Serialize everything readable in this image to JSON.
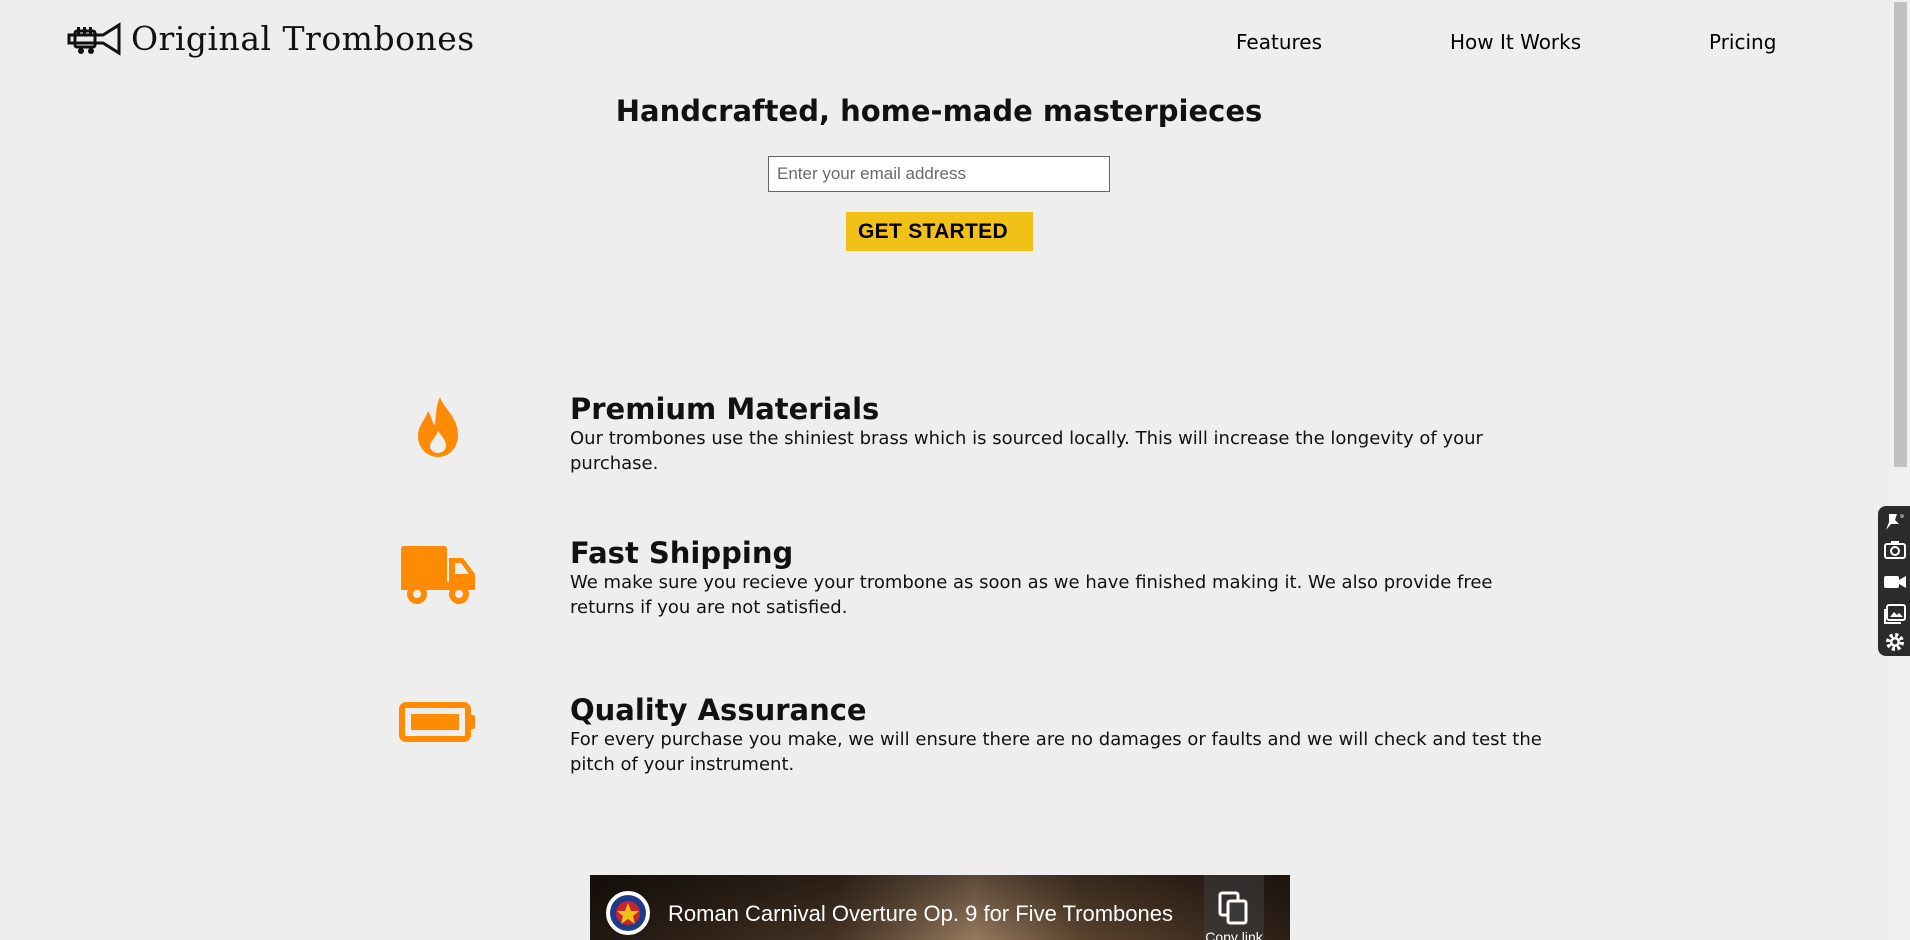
{
  "brand": {
    "name": "Original Trombones",
    "logo_icon": "trumpet-icon"
  },
  "nav": {
    "features": "Features",
    "how_it_works": "How It Works",
    "pricing": "Pricing"
  },
  "hero": {
    "title": "Handcrafted, home-made masterpieces",
    "email_placeholder": "Enter your email address",
    "cta_label": "GET STARTED",
    "cta_color": "#f2c117"
  },
  "features": [
    {
      "icon": "fire-icon",
      "title": "Premium Materials",
      "description": "Our trombones use the shiniest brass which is sourced locally. This will increase the longevity of your purchase."
    },
    {
      "icon": "truck-icon",
      "title": "Fast Shipping",
      "description": "We make sure you recieve your trombone as soon as we have finished making it. We also provide free returns if you are not satisfied."
    },
    {
      "icon": "battery-icon",
      "title": "Quality Assurance",
      "description": "For every purchase you make, we will ensure there are no damages or faults and we will check and test the pitch of your instrument."
    }
  ],
  "accent_color": "#ff8b05",
  "video": {
    "title": "Roman Carnival Overture Op. 9 for Five Trombones",
    "copy_label": "Copy link"
  },
  "toolbar": {
    "tools": [
      "pin-icon",
      "camera-icon",
      "video-camera-icon",
      "gallery-icon",
      "gear-icon"
    ]
  }
}
